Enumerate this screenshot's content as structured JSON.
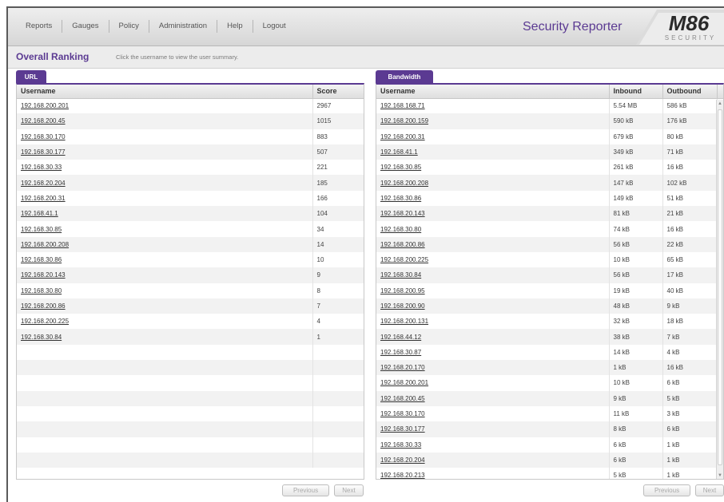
{
  "nav": {
    "items": [
      "Reports",
      "Gauges",
      "Policy",
      "Administration",
      "Help",
      "Logout"
    ]
  },
  "app": {
    "title": "Security Reporter",
    "logo_text": "M86",
    "logo_subtext": "SECURITY",
    "brand_color": "#5b3a92"
  },
  "page": {
    "title": "Overall Ranking",
    "instructions": "Click the username to view the user summary."
  },
  "url_panel": {
    "tab_label": "URL",
    "columns": [
      "Username",
      "Score"
    ],
    "rows": [
      [
        "192.168.200.201",
        "2967"
      ],
      [
        "192.168.200.45",
        "1015"
      ],
      [
        "192.168.30.170",
        "883"
      ],
      [
        "192.168.30.177",
        "507"
      ],
      [
        "192.168.30.33",
        "221"
      ],
      [
        "192.168.20.204",
        "185"
      ],
      [
        "192.168.200.31",
        "166"
      ],
      [
        "192.168.41.1",
        "104"
      ],
      [
        "192.168.30.85",
        "34"
      ],
      [
        "192.168.200.208",
        "14"
      ],
      [
        "192.168.30.86",
        "10"
      ],
      [
        "192.168.20.143",
        "9"
      ],
      [
        "192.168.30.80",
        "8"
      ],
      [
        "192.168.200.86",
        "7"
      ],
      [
        "192.168.200.225",
        "4"
      ],
      [
        "192.168.30.84",
        "1"
      ]
    ],
    "pager": {
      "previous": "Previous",
      "next": "Next"
    }
  },
  "bandwidth_panel": {
    "tab_label": "Bandwidth",
    "columns": [
      "Username",
      "Inbound",
      "Outbound"
    ],
    "rows": [
      [
        "192.168.168.71",
        "5.54 MB",
        "586 kB"
      ],
      [
        "192.168.200.159",
        "590 kB",
        "176 kB"
      ],
      [
        "192.168.200.31",
        "679 kB",
        "80 kB"
      ],
      [
        "192.168.41.1",
        "349 kB",
        "71 kB"
      ],
      [
        "192.168.30.85",
        "261 kB",
        "16 kB"
      ],
      [
        "192.168.200.208",
        "147 kB",
        "102 kB"
      ],
      [
        "192.168.30.86",
        "149 kB",
        "51 kB"
      ],
      [
        "192.168.20.143",
        "81 kB",
        "21 kB"
      ],
      [
        "192.168.30.80",
        "74 kB",
        "16 kB"
      ],
      [
        "192.168.200.86",
        "56 kB",
        "22 kB"
      ],
      [
        "192.168.200.225",
        "10 kB",
        "65 kB"
      ],
      [
        "192.168.30.84",
        "56 kB",
        "17 kB"
      ],
      [
        "192.168.200.95",
        "19 kB",
        "40 kB"
      ],
      [
        "192.168.200.90",
        "48 kB",
        "9 kB"
      ],
      [
        "192.168.200.131",
        "32 kB",
        "18 kB"
      ],
      [
        "192.168.44.12",
        "38 kB",
        "7 kB"
      ],
      [
        "192.168.30.87",
        "14 kB",
        "4 kB"
      ],
      [
        "192.168.20.170",
        "1 kB",
        "16 kB"
      ],
      [
        "192.168.200.201",
        "10 kB",
        "6 kB"
      ],
      [
        "192.168.200.45",
        "9 kB",
        "5 kB"
      ],
      [
        "192.168.30.170",
        "11 kB",
        "3 kB"
      ],
      [
        "192.168.30.177",
        "8 kB",
        "6 kB"
      ],
      [
        "192.168.30.33",
        "6 kB",
        "1 kB"
      ],
      [
        "192.168.20.204",
        "6 kB",
        "1 kB"
      ],
      [
        "192.168.20.213",
        "5 kB",
        "1 kB"
      ]
    ],
    "pager": {
      "previous": "Previous",
      "next": "Next"
    }
  }
}
